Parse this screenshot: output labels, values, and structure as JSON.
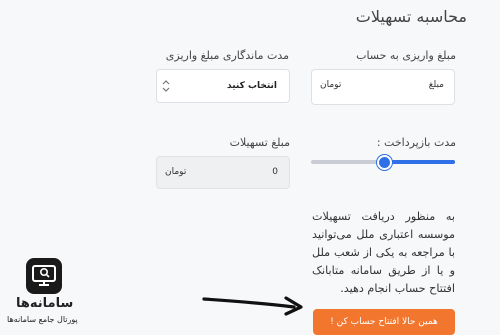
{
  "page": {
    "title": "محاسبه تسهیلات"
  },
  "deposit": {
    "label": "مبلغ واریزی به حساب",
    "prefix": "مبلغ",
    "unit": "تومان"
  },
  "duration": {
    "label": "مدت ماندگاری مبلغ واریزی",
    "selected": "انتخاب کنید"
  },
  "repayment": {
    "label": "مدت بازپرداخت :",
    "value_fraction": 0.5
  },
  "loan": {
    "label": "مبلغ تسهیلات",
    "value": "0",
    "unit": "تومان"
  },
  "info": {
    "text": "به منظور دریافت تسهیلات موسسه اعتباری ملل می‌توانید با مراجعه به یکی از شعب ملل و یا از طریق سامانه متابانک افتتاح حساب انجام دهید."
  },
  "cta": {
    "label": "همین حالا افتتاح حساب کن !"
  },
  "watermark": {
    "brand": "سامانه‌ها",
    "tagline": "پورتال جامع سامانه‌ها",
    "colors": {
      "icon_bg": "#1a1a1a",
      "accent": "#f2762e",
      "primary": "#2f6fe8"
    }
  }
}
